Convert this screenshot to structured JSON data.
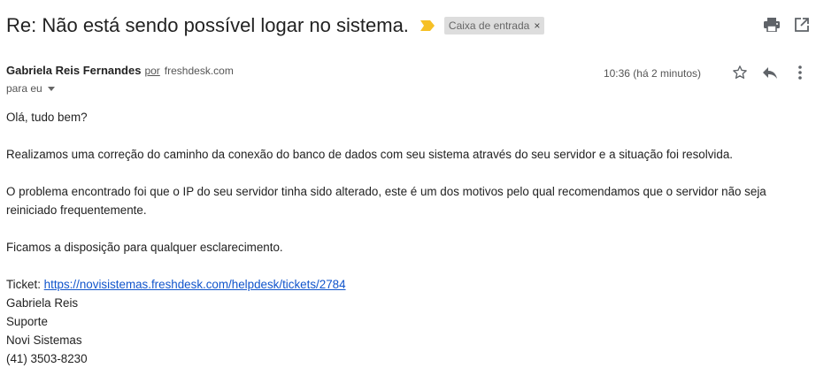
{
  "header": {
    "subject": "Re: Não está sendo possível logar no sistema.",
    "importance_icon": "importance-marker-icon",
    "label": "Caixa de entrada",
    "label_close": "×",
    "actions": {
      "print_icon": "print-icon",
      "new_window_icon": "open-in-new-window-icon"
    }
  },
  "message": {
    "sender_name": "Gabriela Reis Fernandes",
    "via_label": "por",
    "via_domain": "freshdesk.com",
    "timestamp": "10:36 (há 2 minutos)",
    "recipient": "para eu",
    "actions": {
      "star_icon": "star-icon",
      "reply_icon": "reply-icon",
      "more_icon": "more-vert-icon"
    },
    "body": {
      "greeting": "Olá, tudo bem?",
      "paragraph1": "Realizamos uma correção do caminho da conexão do banco de dados com seu sistema através do seu servidor e a situação foi resolvida.",
      "paragraph2": "O problema encontrado foi que o IP do seu servidor tinha sido alterado, este é um dos motivos pelo qual recomendamos que o servidor não seja reiniciado frequentemente.",
      "paragraph3": "Ficamos a disposição para qualquer esclarecimento.",
      "ticket_label": "Ticket: ",
      "ticket_link": "https://novisistemas.freshdesk.com/helpdesk/tickets/2784",
      "signature": [
        "Gabriela Reis",
        "Suporte",
        "Novi Sistemas",
        "(41) 3503-8230"
      ]
    }
  },
  "colors": {
    "importance": "#f6c026",
    "link": "#1155cc",
    "chip_bg": "#dddddd"
  }
}
